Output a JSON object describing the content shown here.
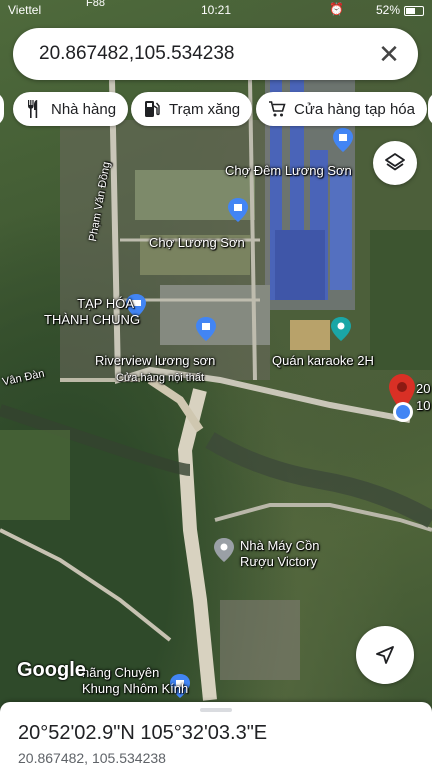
{
  "status": {
    "carrier": "Viettel",
    "top_label": "F88",
    "time": "10:21",
    "battery": "52%"
  },
  "search": {
    "query": "20.867482,105.534238",
    "close_label": "✕"
  },
  "chips": [
    {
      "label": "Nhà hàng",
      "icon": "fork-knife-icon"
    },
    {
      "label": "Trạm xăng",
      "icon": "gas-station-icon"
    },
    {
      "label": "Cửa hàng tạp hóa",
      "icon": "shopping-cart-icon"
    }
  ],
  "map_labels": {
    "night_market": "Chợ Đêm Lương Sơn",
    "market": "Chợ Lương Sơn",
    "street": "Phạm Văn Đồng",
    "grocery_line1": "TẠP HÓA",
    "grocery_line2": "THÀNH CHUNG",
    "riverview": "Riverview lương sơn",
    "furniture": "Cửa hàng nội thất",
    "karaoke": "Quán karaoke 2H",
    "van_dan": "Vân Đàn",
    "factory_line1": "Nhà Máy Cồn",
    "factory_line2": "Rượu Victory",
    "aluminium_line1": "hãng Chuyên",
    "aluminium_line2": "Khung Nhôm Kính",
    "pin_label_1": "20",
    "pin_label_2": "10"
  },
  "google_logo": "Google",
  "sheet": {
    "dms": "20°52'02.9\"N 105°32'03.3\"E",
    "decimal": "20.867482, 105.534238"
  },
  "colors": {
    "pin_red": "#d93025",
    "location_blue": "#4285f4",
    "poi_blue": "#4285f4",
    "poi_teal": "#1aa6a6"
  }
}
